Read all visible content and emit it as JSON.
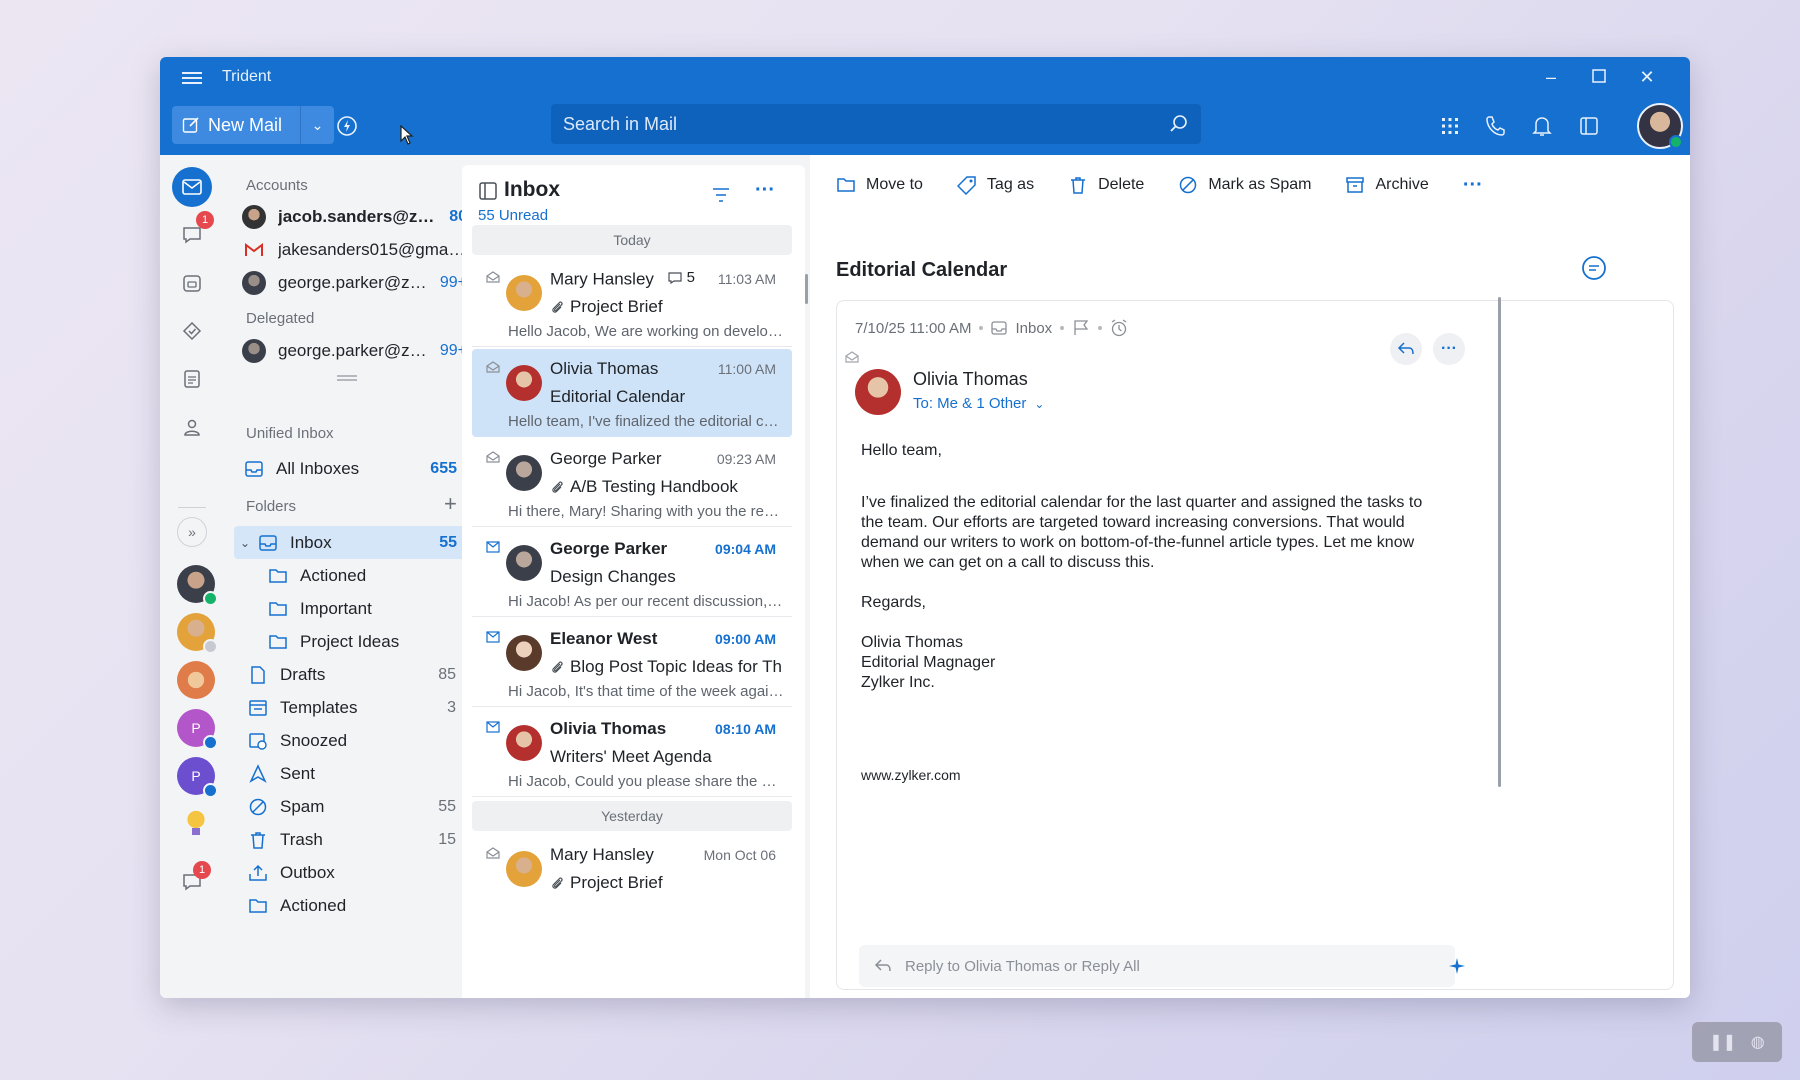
{
  "app": {
    "title": "Trident"
  },
  "toolbar": {
    "new_mail_label": "New Mail",
    "search_placeholder": "Search in Mail",
    "accent_color": "#1570cf"
  },
  "rail": {
    "chat_badge": "1",
    "bottom_badge": "1",
    "contacts": [
      {
        "name": "contact-1",
        "initial": ""
      },
      {
        "name": "contact-2",
        "initial": ""
      },
      {
        "name": "contact-3",
        "initial": ""
      },
      {
        "name": "contact-p1",
        "initial": "P"
      },
      {
        "name": "contact-p2",
        "initial": "P"
      },
      {
        "name": "contact-bulb",
        "initial": ""
      }
    ]
  },
  "folders": {
    "accounts_title": "Accounts",
    "accounts": [
      {
        "email": "jacob.sanders@zylke...",
        "count": "80",
        "bold": true
      },
      {
        "email": "jakesanders015@gmail.c...",
        "count": ""
      },
      {
        "email": "george.parker@zylk...",
        "count": "99+"
      }
    ],
    "delegated_title": "Delegated",
    "delegated": [
      {
        "email": "george.parker@zylk...",
        "count": "99+"
      }
    ],
    "unified_title": "Unified Inbox",
    "all_inboxes": {
      "label": "All Inboxes",
      "count": "655"
    },
    "folders_title": "Folders",
    "items": [
      {
        "label": "Inbox",
        "count": "55"
      },
      {
        "label": "Actioned",
        "count": ""
      },
      {
        "label": "Important",
        "count": ""
      },
      {
        "label": "Project Ideas",
        "count": ""
      },
      {
        "label": "Drafts",
        "count": "85"
      },
      {
        "label": "Templates",
        "count": "3"
      },
      {
        "label": "Snoozed",
        "count": ""
      },
      {
        "label": "Sent",
        "count": ""
      },
      {
        "label": "Spam",
        "count": "55"
      },
      {
        "label": "Trash",
        "count": "15"
      },
      {
        "label": "Outbox",
        "count": ""
      },
      {
        "label": "Actioned",
        "count": ""
      }
    ]
  },
  "list": {
    "title": "Inbox",
    "unread": "55 Unread",
    "group_today": "Today",
    "group_yesterday": "Yesterday",
    "messages": [
      {
        "from": "Mary Hansley",
        "thread": "5",
        "time": "11:03 AM",
        "subject": "Project Brief",
        "preview": "Hello Jacob, We are working on developin...",
        "unread": false,
        "attach": true
      },
      {
        "from": "Olivia Thomas",
        "thread": "",
        "time": "11:00 AM",
        "subject": "Editorial Calendar",
        "preview": "Hello team, I've finalized the editorial cale...",
        "unread": false,
        "attach": false
      },
      {
        "from": "George Parker",
        "thread": "",
        "time": "09:23 AM",
        "subject": "A/B Testing Handbook",
        "preview": "Hi there, Mary! Sharing with you the requ...",
        "unread": false,
        "attach": true
      },
      {
        "from": "George Parker",
        "thread": "",
        "time": "09:04 AM",
        "subject": "Design Changes",
        "preview": "Hi Jacob! As per our recent discussion, I a...",
        "unread": true,
        "attach": false
      },
      {
        "from": "Eleanor West",
        "thread": "",
        "time": "09:00 AM",
        "subject": "Blog Post Topic Ideas for Thi...",
        "preview": "Hi Jacob, It's that time of the week again...",
        "unread": true,
        "attach": true
      },
      {
        "from": "Olivia Thomas",
        "thread": "",
        "time": "08:10 AM",
        "subject": "Writers' Meet Agenda",
        "preview": "Hi Jacob, Could you please share the agen...",
        "unread": true,
        "attach": false
      },
      {
        "from": "Mary Hansley",
        "thread": "",
        "time": "Mon Oct 06",
        "subject": "Project Brief",
        "preview": "",
        "unread": false,
        "attach": true
      }
    ]
  },
  "reader": {
    "actions": [
      "Move to",
      "Tag as",
      "Delete",
      "Mark as Spam",
      "Archive"
    ],
    "subject": "Editorial Calendar",
    "date": "7/10/25 11:00 AM",
    "folder": "Inbox",
    "sender": "Olivia Thomas",
    "to": "To: Me & 1 Other",
    "greeting": "Hello team,",
    "paragraph": "I’ve finalized the editorial calendar for the last quarter and assigned the tasks to\nthe team. Our efforts are targeted toward increasing conversions. That would\ndemand our writers to work on bottom-of-the-funnel article types. Let me know\nwhen we can get on a call to discuss this.",
    "regards": "Regards,",
    "signature": "Olivia Thomas\nEditorial Magnager\nZylker Inc.",
    "url": "www.zylker.com",
    "reply_placeholder": "Reply to Olivia Thomas or Reply All"
  }
}
